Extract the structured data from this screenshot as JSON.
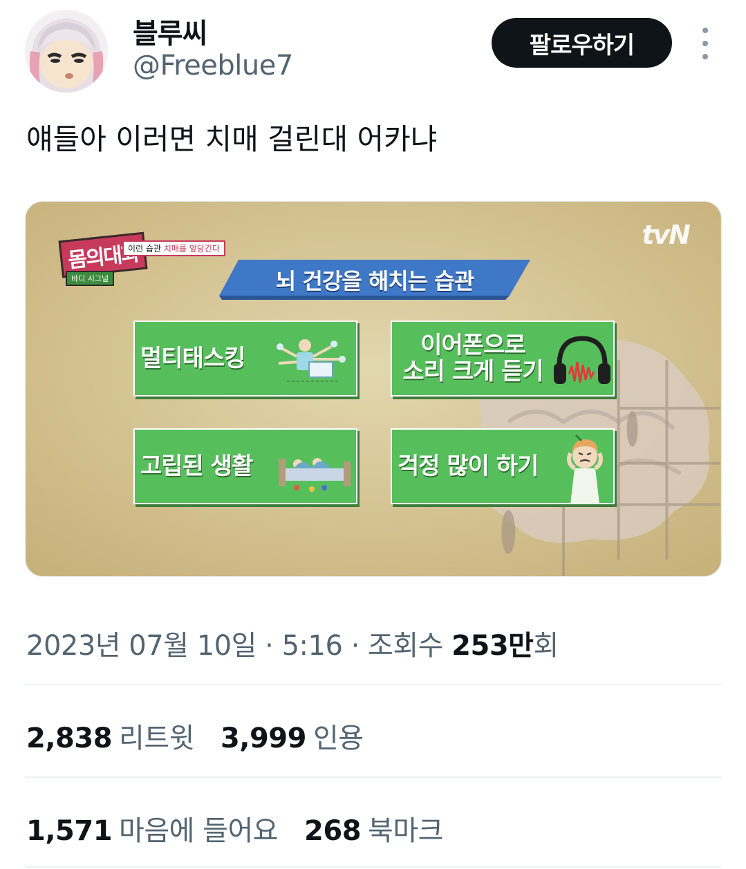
{
  "user": {
    "display_name": "블루씨",
    "handle": "@Freeblue7",
    "follow_label": "팔로우하기"
  },
  "tweet": {
    "text": "얘들아 이러면 치매 걸린대 어카냐"
  },
  "media": {
    "broadcaster": "tvN",
    "show_logo": "몸의대화",
    "show_logo_sub": "바디 시그널",
    "show_subtitle_prefix": "이런 습관",
    "show_subtitle_highlight": "치매를 앞당긴다",
    "banner_title": "뇌 건강을 해치는 습관",
    "cards": [
      {
        "label": "멀티태스킹"
      },
      {
        "label": "이어폰으로\n소리 크게 듣기"
      },
      {
        "label": "고립된 생활"
      },
      {
        "label": "걱정 많이 하기"
      }
    ]
  },
  "meta": {
    "date": "2023년 07월 10일 · 5:16 · 조회수 ",
    "views_number": "253만",
    "views_suffix": "회"
  },
  "stats": {
    "retweets_count": "2,838",
    "retweets_label": "리트윗",
    "quotes_count": "3,999",
    "quotes_label": "인용",
    "likes_count": "1,571",
    "likes_label": "마음에 들어요",
    "bookmarks_count": "268",
    "bookmarks_label": "북마크"
  },
  "colors": {
    "text_primary": "#0f1419",
    "text_secondary": "#536471",
    "card_green": "#56bf5c",
    "banner_blue": "#3f78c6",
    "media_bg": "#d6c698"
  }
}
